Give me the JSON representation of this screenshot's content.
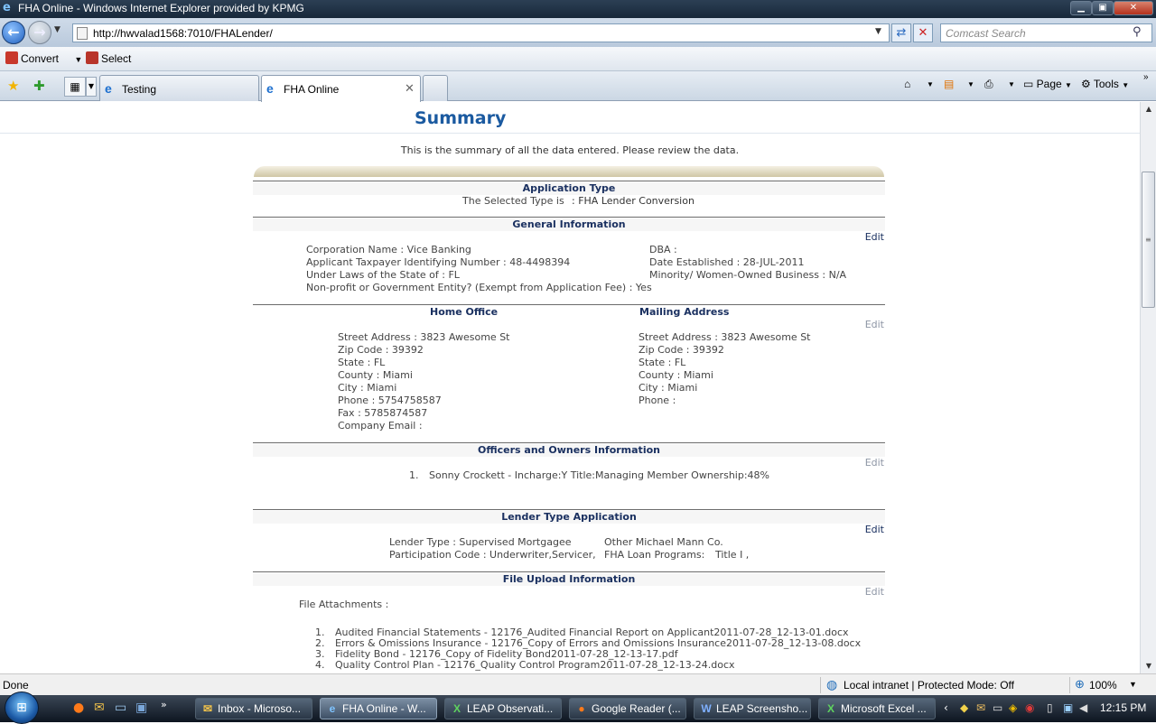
{
  "window": {
    "title": "FHA Online - Windows Internet Explorer provided by KPMG"
  },
  "address_bar": {
    "url": "http://hwvalad1568:7010/FHALender/",
    "search_placeholder": "Comcast Search"
  },
  "command_bar": {
    "convert_label": "Convert",
    "select_label": "Select"
  },
  "tabs": [
    {
      "label": "Testing"
    },
    {
      "label": "FHA Online"
    }
  ],
  "tab_tools": {
    "page_label": "Page",
    "tools_label": "Tools"
  },
  "summary": {
    "title": "Summary",
    "intro": "This is the summary of all the data entered. Please review the data.",
    "edit_label": "Edit",
    "application_type": {
      "heading": "Application Type",
      "label": "The Selected Type is",
      "value": ": FHA Lender Conversion"
    },
    "general_information": {
      "heading": "General Information",
      "corporation_name": "Corporation Name : Vice Banking",
      "tin": "Applicant Taxpayer Identifying Number : 48-4498394",
      "state_laws": "Under Laws of the State of : FL",
      "non_profit": "Non-profit or Government Entity? (Exempt from Application Fee) : Yes",
      "dba": "DBA :",
      "date_established": "Date Established : 28-JUL-2011",
      "minority": "Minority/ Women-Owned Business : N/A"
    },
    "home_office": {
      "heading": "Home Office",
      "street": "Street Address : 3823 Awesome St",
      "zip": "Zip Code : 39392",
      "state": "State : FL",
      "county": "County : Miami",
      "city": "City : Miami",
      "phone": "Phone : 5754758587",
      "fax": "Fax : 5785874587",
      "email": "Company Email :"
    },
    "mailing_address": {
      "heading": "Mailing Address",
      "street": "Street Address : 3823 Awesome St",
      "zip": "Zip Code : 39392",
      "state": "State : FL",
      "county": "County : Miami",
      "city": "City : Miami",
      "phone": "Phone :"
    },
    "officers": {
      "heading": "Officers and Owners Information",
      "items": [
        {
          "num": "1.",
          "text": "Sonny Crockett - Incharge:Y Title:Managing Member Ownership:48%"
        }
      ]
    },
    "lender_type": {
      "heading": "Lender Type Application",
      "lender_type": "Lender Type : Supervised Mortgagee",
      "participation": "Participation Code : Underwriter,Servicer,",
      "other": "Other Michael Mann Co.",
      "programs_label": "FHA Loan Programs:",
      "programs_value": "Title I ,"
    },
    "file_upload": {
      "heading": "File Upload Information",
      "attachments_label": "File Attachments :",
      "files": [
        {
          "num": "1.",
          "text": "Audited Financial Statements - 12176_Audited Financial Report on Applicant2011-07-28_12-13-01.docx"
        },
        {
          "num": "2.",
          "text": "Errors & Omissions Insurance - 12176_Copy of Errors and Omissions Insurance2011-07-28_12-13-08.docx"
        },
        {
          "num": "3.",
          "text": "Fidelity Bond - 12176_Copy of Fidelity Bond2011-07-28_12-13-17.pdf"
        },
        {
          "num": "4.",
          "text": "Quality Control Plan - 12176_Quality Control Program2011-07-28_12-13-24.docx"
        }
      ]
    }
  },
  "status_bar": {
    "status": "Done",
    "zone": "Local intranet | Protected Mode: Off",
    "zoom": "100%"
  },
  "taskbar": {
    "buttons": [
      {
        "label": "Inbox - Microso...",
        "icon": "outlook-icon"
      },
      {
        "label": "FHA Online - W...",
        "icon": "ie-icon"
      },
      {
        "label": "LEAP Observati...",
        "icon": "excel-icon"
      },
      {
        "label": "Google Reader (...",
        "icon": "firefox-icon"
      },
      {
        "label": "LEAP Screensho...",
        "icon": "word-icon"
      },
      {
        "label": "Microsoft Excel ...",
        "icon": "excel-icon"
      }
    ],
    "clock": "12:15 PM"
  }
}
